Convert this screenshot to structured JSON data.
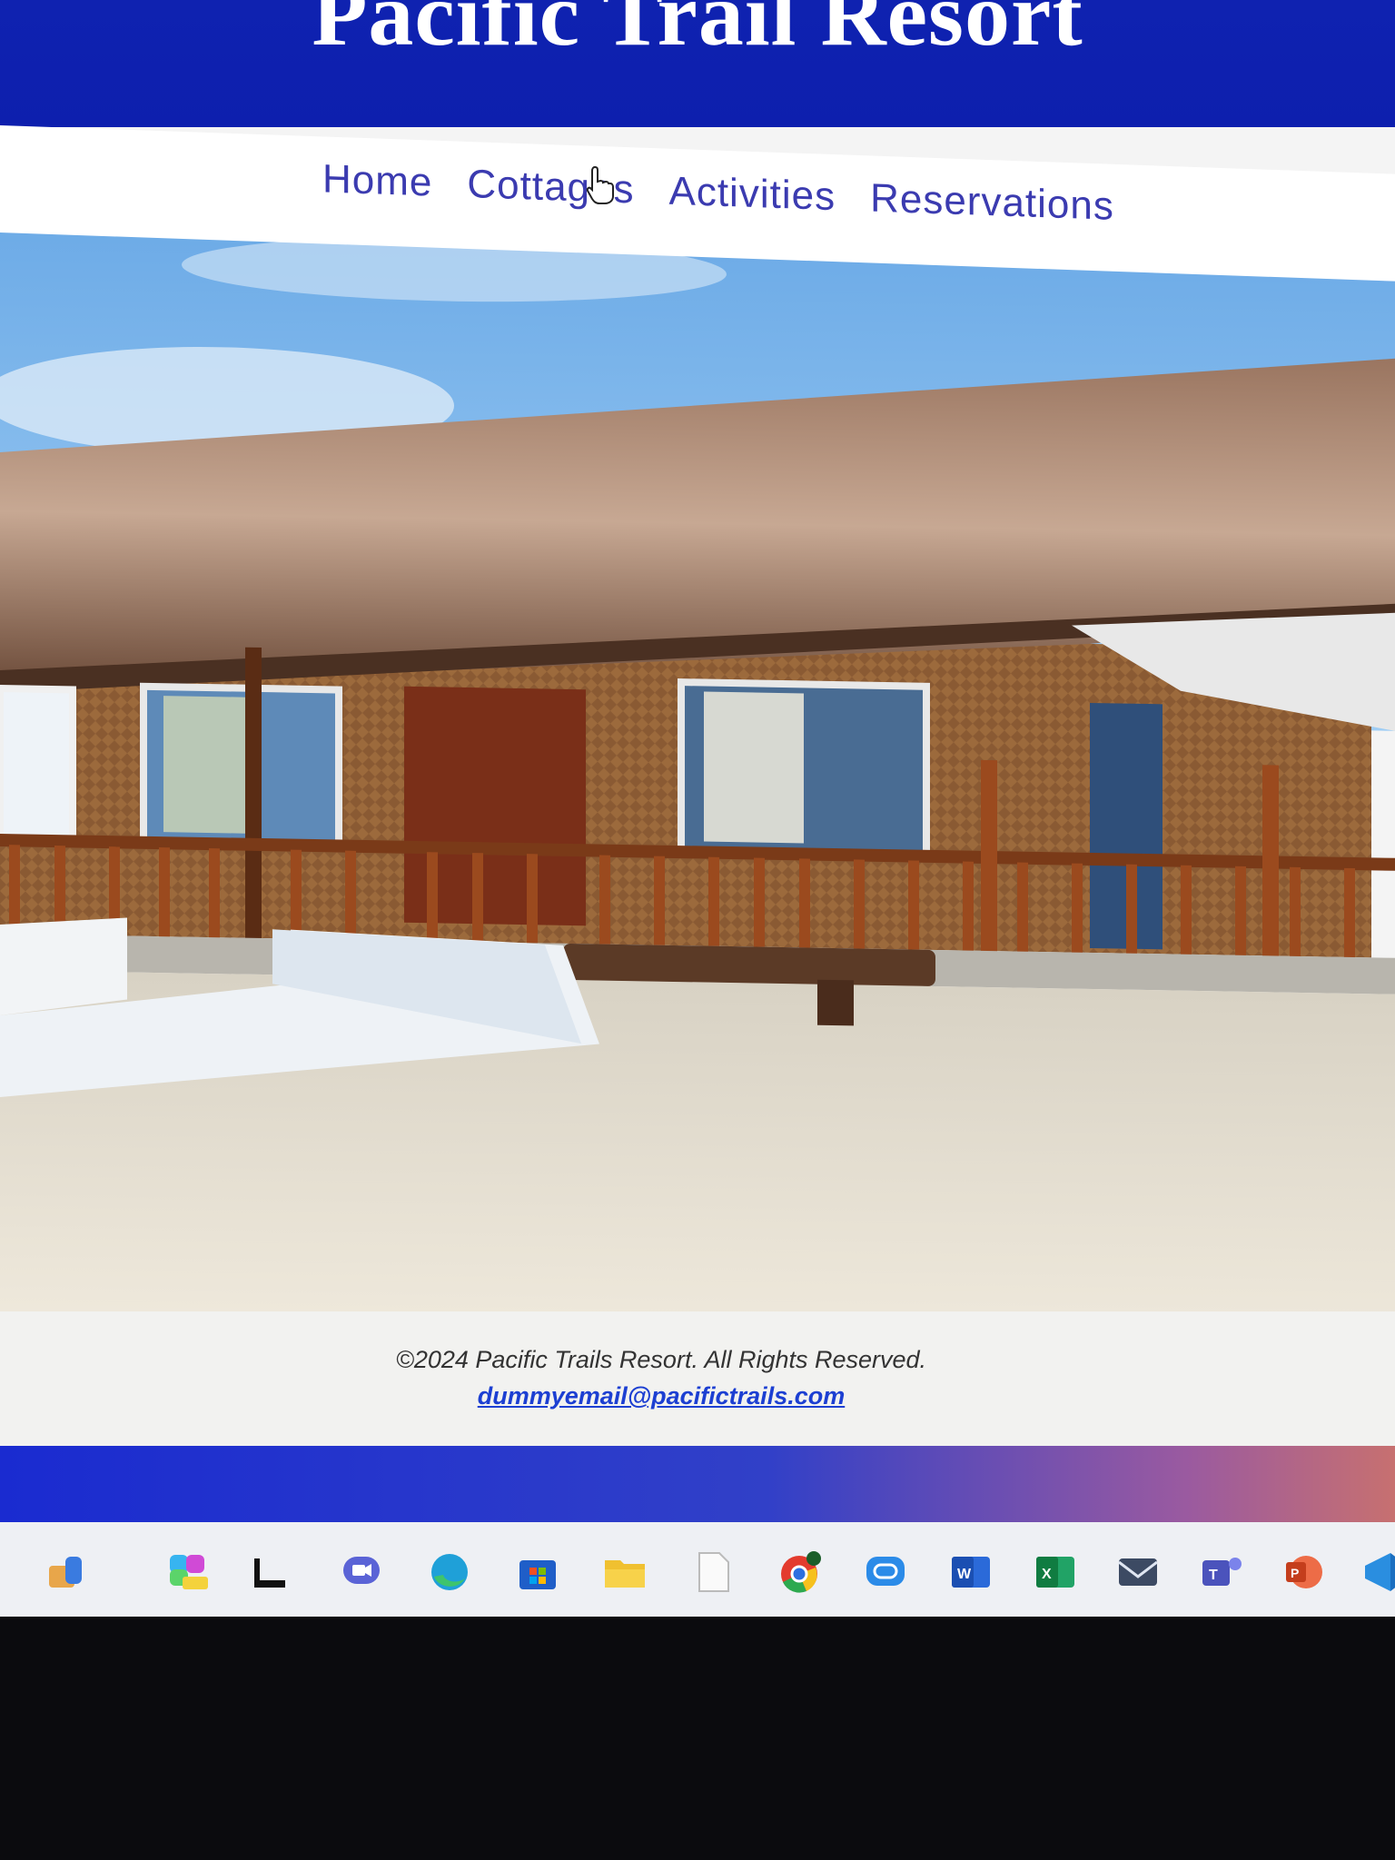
{
  "site": {
    "title": "Pacific Trail Resort"
  },
  "nav": {
    "items": [
      {
        "label": "Home"
      },
      {
        "label": "Cottages"
      },
      {
        "label": "Activities"
      },
      {
        "label": "Reservations"
      }
    ]
  },
  "hero": {
    "image": "thatched-cottage-beach-photo"
  },
  "footer": {
    "copyright": "©2024 Pacific Trails Resort. All Rights Reserved.",
    "email": "dummyemail@pacifictrails.com"
  },
  "colors": {
    "header_bg": "#0f22b0",
    "nav_text": "#3b3bb0",
    "email_link": "#1c3fd2"
  },
  "taskbar": {
    "icons": [
      "widgets-icon",
      "copilot-pre-icon",
      "terminal-icon",
      "teams-chat-icon",
      "edge-icon",
      "store-icon",
      "file-explorer-icon",
      "notepad-icon",
      "chrome-icon",
      "phone-link-icon",
      "word-icon",
      "excel-icon",
      "mail-icon",
      "teams-icon",
      "powerpoint-icon",
      "vscode-icon"
    ]
  }
}
